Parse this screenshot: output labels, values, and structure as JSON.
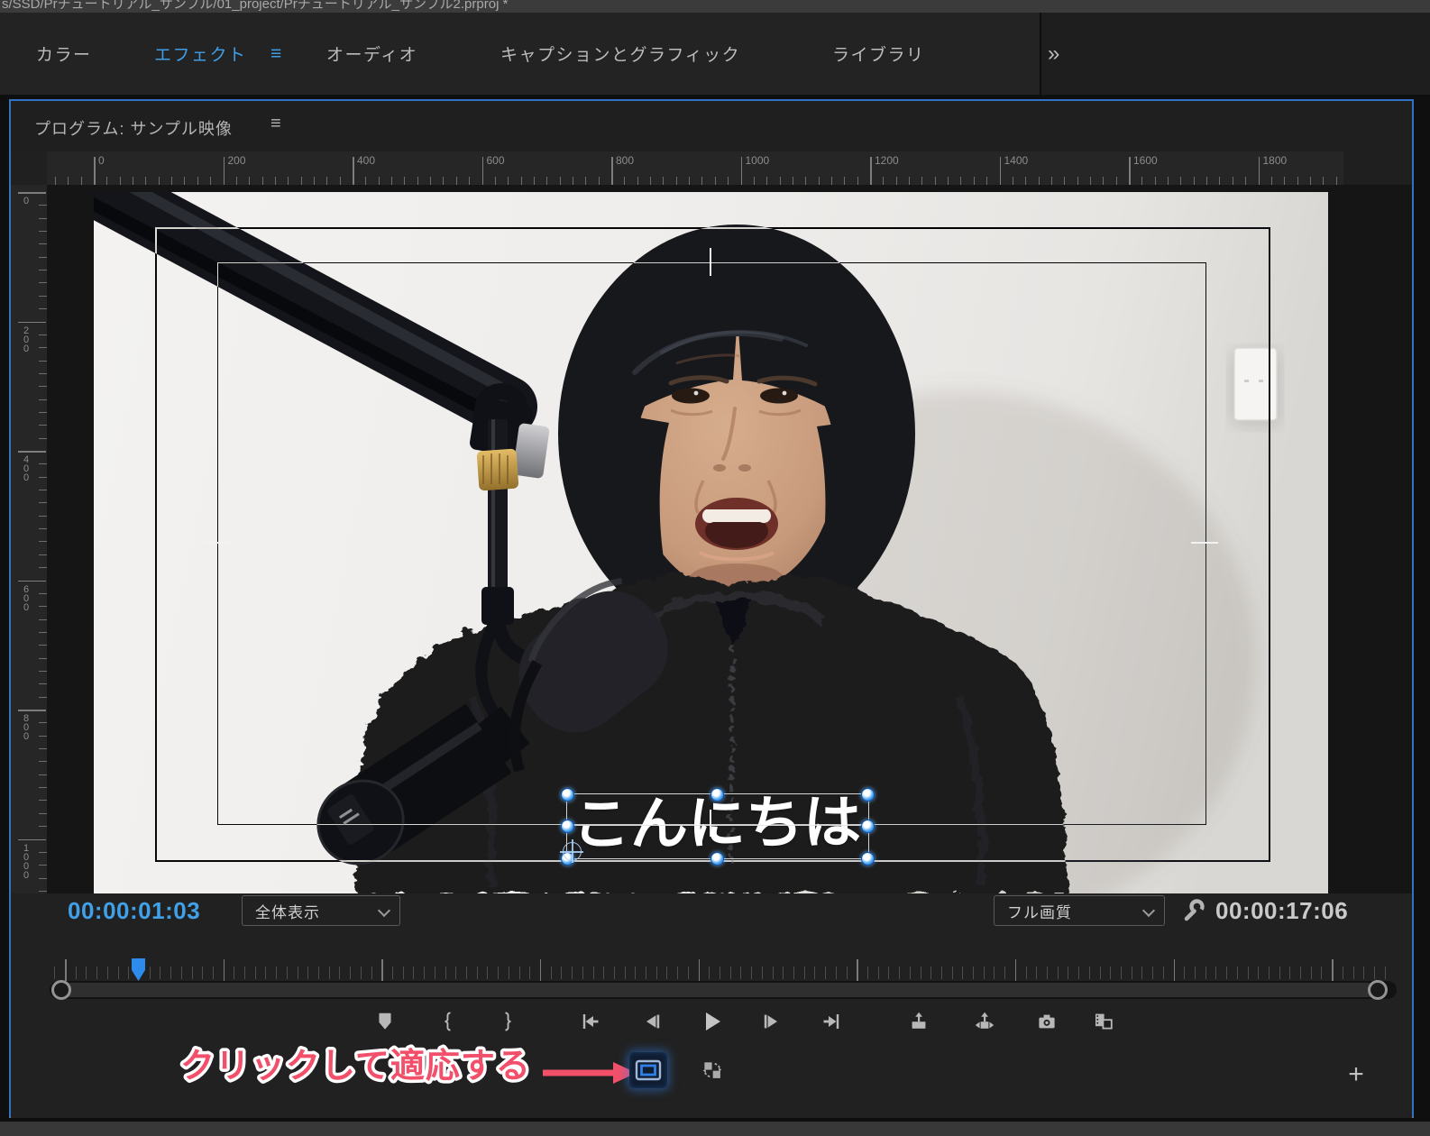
{
  "window": {
    "title_path": "s/SSD/Prチュートリアル_サンプル/01_project/Prチュートリアル_サンプル2.prproj *"
  },
  "workspace": {
    "tabs": [
      {
        "label": "カラー",
        "active": false
      },
      {
        "label": "エフェクト",
        "active": true
      },
      {
        "label": "オーディオ",
        "active": false
      },
      {
        "label": "キャプションとグラフィック",
        "active": false
      },
      {
        "label": "ライブラリ",
        "active": false
      }
    ],
    "active_tab_menu_icon": "≡",
    "overflow_icon": "»"
  },
  "program_monitor": {
    "panel_title": "プログラム: サンプル映像",
    "panel_menu_icon": "≡",
    "h_ruler_labels": [
      "0",
      "200",
      "400",
      "600",
      "800",
      "1000",
      "1200",
      "1400",
      "1600",
      "1800"
    ],
    "v_ruler_labels": [
      "0",
      "200",
      "400",
      "600",
      "800",
      "1000"
    ],
    "overlay": {
      "text": "こんにちは"
    },
    "playhead_timecode": "00:00:01:03",
    "zoom_level": "全体表示",
    "playback_quality": "フル画質",
    "duration_timecode": "00:00:17:06"
  },
  "transport": {
    "buttons": [
      "add-marker",
      "mark-in",
      "mark-out",
      "go-to-in",
      "step-back",
      "play",
      "step-forward",
      "go-to-out",
      "lift",
      "extract",
      "export-frame",
      "comparison-view"
    ],
    "secondary_buttons": [
      "safe-margins",
      "toggle-proxies"
    ],
    "add_button_icon": "+"
  },
  "annotation": {
    "text": "クリックして適応する",
    "color": "#f2506a"
  },
  "colors": {
    "accent_blue": "#2d8ceb",
    "timecode_blue": "#40a0e8",
    "panel_focus_border": "#3173c2",
    "active_tab_blue": "#3f9ee8"
  }
}
